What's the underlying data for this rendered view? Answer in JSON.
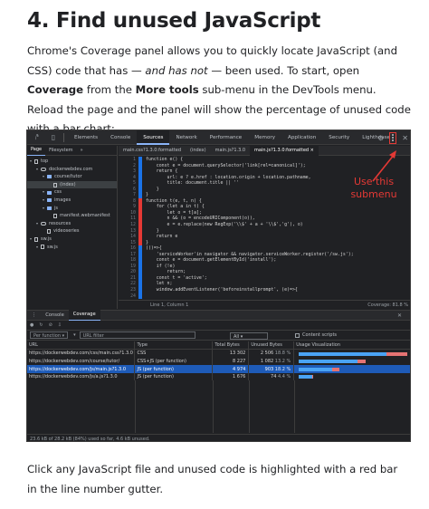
{
  "heading": "4. Find unused JavaScript",
  "intro": {
    "p1": "Chrome's Coverage panel allows you to quickly locate JavaScript (and CSS) code that has — ",
    "em": "and has not",
    "p2": " — been used. To start, open ",
    "b1": "Coverage",
    "p3": " from the ",
    "b2": "More tools",
    "p4": " sub-menu in the DevTools menu. Reload the page and the panel will show the percentage of unused code with a bar chart:"
  },
  "devtools": {
    "tabs": [
      "Elements",
      "Console",
      "Sources",
      "Network",
      "Performance",
      "Memory",
      "Application",
      "Security",
      "Lighthouse"
    ],
    "active_tab": "Sources",
    "nav_tabs": [
      "Page",
      "Filesystem",
      "»"
    ],
    "tree": [
      {
        "label": "top",
        "indent": 0,
        "kind": "file-frame"
      },
      {
        "label": "dockerwebdev.com",
        "indent": 1,
        "kind": "cloud"
      },
      {
        "label": "course/tutor",
        "indent": 2,
        "kind": "folder"
      },
      {
        "label": "(index)",
        "indent": 3,
        "kind": "file",
        "selected": true
      },
      {
        "label": "css",
        "indent": 2,
        "kind": "folder"
      },
      {
        "label": "images",
        "indent": 2,
        "kind": "folder"
      },
      {
        "label": "js",
        "indent": 2,
        "kind": "folder"
      },
      {
        "label": "manifest.webmanifest",
        "indent": 3,
        "kind": "file"
      },
      {
        "label": "resources",
        "indent": 1,
        "kind": "cloud"
      },
      {
        "label": "videoseries",
        "indent": 2,
        "kind": "file"
      },
      {
        "label": "sw.js",
        "indent": 0,
        "kind": "file-frame"
      },
      {
        "label": "sw.js",
        "indent": 1,
        "kind": "file-frame"
      }
    ],
    "editor_tabs": [
      "main.css?1.3.0:formatted",
      "(index)",
      "main.js?1.3.0",
      "main.js?1.3.0:formatted ×"
    ],
    "editor_active_tab": "main.js?1.3.0:formatted ×",
    "code_lines": [
      {
        "n": "1",
        "g": "c",
        "t": "function e() {"
      },
      {
        "n": "2",
        "g": "c",
        "t": "    const e = document.querySelector('link[rel=canonical]');"
      },
      {
        "n": "3",
        "g": "c",
        "t": "    return {"
      },
      {
        "n": "4",
        "g": "c",
        "t": "        url: e ? e.href : location.origin + location.pathname,"
      },
      {
        "n": "5",
        "g": "c",
        "t": "        title: document.title || ''"
      },
      {
        "n": "6",
        "g": "c",
        "t": "    }"
      },
      {
        "n": "7",
        "g": "c",
        "t": "}"
      },
      {
        "n": "8",
        "g": "u",
        "t": "function t(e, t, n) {"
      },
      {
        "n": "9",
        "g": "u",
        "t": "    for (let a in t) {"
      },
      {
        "n": "10",
        "g": "u",
        "t": "        let o = t[a];"
      },
      {
        "n": "11",
        "g": "u",
        "t": "        n && (o = encodeURIComponent(o)),"
      },
      {
        "n": "12",
        "g": "u",
        "t": "        e = e.replace(new RegExp('\\\\$' + a + '\\\\$','g'), o)"
      },
      {
        "n": "13",
        "g": "u",
        "t": "    }"
      },
      {
        "n": "14",
        "g": "u",
        "t": "    return e"
      },
      {
        "n": "15",
        "g": "u",
        "t": "}"
      },
      {
        "n": "16",
        "g": "c",
        "t": "(()=>{"
      },
      {
        "n": "17",
        "g": "c",
        "t": "    'serviceWorker'in navigator && navigator.serviceWorker.register('/sw.js');"
      },
      {
        "n": "18",
        "g": "c",
        "t": "    const e = document.getElementById('install');"
      },
      {
        "n": "19",
        "g": "c",
        "t": "    if (!e)"
      },
      {
        "n": "20",
        "g": "c",
        "t": "        return;"
      },
      {
        "n": "21",
        "g": "c",
        "t": "    const t = 'active';"
      },
      {
        "n": "22",
        "g": "c",
        "t": "    let n;"
      },
      {
        "n": "23",
        "g": "c",
        "t": "    window.addEventListener('beforeinstallprompt', (e)=>{"
      },
      {
        "n": "24",
        "g": "c",
        "t": ""
      }
    ],
    "editor_status": "Line 1, Column 1",
    "editor_coverage": "Coverage: 81.8 %",
    "annotation": "Use this submenu",
    "drawer_tabs": [
      "Console",
      "Coverage"
    ],
    "drawer_active_tab": "Coverage",
    "type_select": "Per function",
    "url_filter_placeholder": "URL filter",
    "all_select": "All",
    "content_scripts": "Content scripts",
    "columns": [
      "URL",
      "Type",
      "Total Bytes",
      "Unused Bytes",
      "Usage Visualization"
    ],
    "rows": [
      {
        "url": "https://dockerwebdev.com/css/main.css?1.3.0",
        "type": "CSS",
        "total": "13 302",
        "unused": "2 506",
        "pct": "18.8 %",
        "used_frac": 0.81,
        "highlight": false
      },
      {
        "url": "https://dockerwebdev.com/course/tutor/",
        "type": "CSS+JS (per function)",
        "total": "8 227",
        "unused": "1 082",
        "pct": "13.2 %",
        "used_frac": 0.87,
        "highlight": false
      },
      {
        "url": "https://dockerwebdev.com/js/main.js?1.3.0",
        "type": "JS (per function)",
        "total": "4 974",
        "unused": "903",
        "pct": "18.2 %",
        "used_frac": 0.82,
        "highlight": true
      },
      {
        "url": "https://dockerwebdev.com/js/a.js?1.3.0",
        "type": "JS (per function)",
        "total": "1 676",
        "unused": "74",
        "pct": "4.4 %",
        "used_frac": 0.96,
        "highlight": false
      }
    ],
    "row_total_scale": [
      13302,
      8227,
      4974,
      1676
    ],
    "status": "23.6 kB of 28.2 kB (84%) used so far, 4.6 kB unused."
  },
  "outro": "Click any JavaScript file and unused code is highlighted with a red bar in the line number gutter."
}
